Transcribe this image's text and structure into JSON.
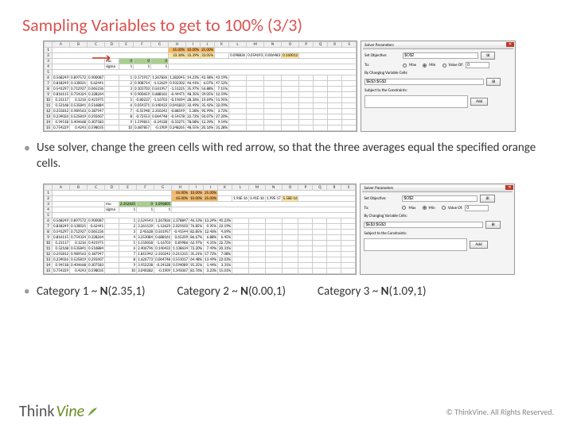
{
  "title": "Sampling Variables to get to 100% (3/3)",
  "bullet1": "Use solver, change the green cells with red arrow, so that the three averages equal the specified orange cells.",
  "cat1": "Category 1 ~ N(2.35,1)",
  "cat2": "Category 2 ~ N(0.00,1)",
  "cat3": "Category 3 ~ N(1.09,1)",
  "footer": {
    "brand1": "Think",
    "brand2": "Vine",
    "copy": "© ThinkVine.  All Rights Reserved."
  },
  "cols": [
    "A",
    "B",
    "C",
    "D",
    "E",
    "F",
    "G",
    "H",
    "I",
    "J",
    "K",
    "L",
    "M",
    "N",
    "O",
    "P",
    "Q",
    "R",
    "S"
  ],
  "solver": {
    "title": "Solver Parameters",
    "obj_lbl": "Set Objective:",
    "obj_val": "$O$2",
    "to_lbl": "To:",
    "max": "Max",
    "min": "Min",
    "valof": "Value Of:",
    "zero": "0",
    "chg_lbl": "By Changing Variable Cells:",
    "chg_val": "$E$3:$G$3",
    "sub_lbl": "Subject to the Constraints:",
    "add": "Add"
  },
  "shot1": {
    "mu_lbl": "mu",
    "sigma_lbl": "sigma",
    "mu": [
      "0",
      "0",
      "0"
    ],
    "sigma": [
      "1",
      "1",
      "1"
    ],
    "r1_orange": [
      "65.00%",
      "10.00%",
      "25.00%"
    ],
    "r2_yellow": [
      "33.36%",
      "33.39%",
      "33.05%"
    ],
    "r2_L": [
      "0.098836",
      "0.054693",
      "0.006483"
    ],
    "r2_Lsum": "0.160012",
    "rows": [
      [
        "6",
        "0.568249",
        "0.897572",
        "0.900087",
        "",
        "1",
        "0.171917",
        "1.267836",
        "1.282045",
        "14.23%",
        "42.58%",
        "43.19%"
      ],
      [
        "7",
        "0.818249",
        "0.130021",
        "0.62441",
        "",
        "2",
        "0.908714",
        "-1.12629",
        "0.932302",
        "46.41%",
        "6.07%",
        "47.52%"
      ],
      [
        "8",
        "0.541297",
        "0.712927",
        "0.065236",
        "",
        "3",
        "0.103703",
        "0.561957",
        "-1.51225",
        "35.97%",
        "56.88%",
        "7.15%"
      ],
      [
        "9",
        "0.816115",
        "0.754324",
        "0.328264",
        "",
        "4",
        "0.900659",
        "0.688161",
        "-0.44471",
        "48.35%",
        "39.05%",
        "12.59%"
      ],
      [
        "10",
        "0.21117",
        "0.1216",
        "0.421975",
        "",
        "5",
        "-0.80237",
        "-1.16703",
        "-0.19694",
        "28.36%",
        "19.69%",
        "51.95%"
      ],
      [
        "11",
        "0.52168",
        "0.535841",
        "0.516884",
        "",
        "6",
        "0.054371",
        "0.140433",
        "0.041833",
        "32.49%",
        "35.42%",
        "32.09%"
      ],
      [
        "12",
        "0.255812",
        "0.989563",
        "0.187947",
        "",
        "7",
        "-0.55948",
        "2.310242",
        "-0.88549",
        "5.28%",
        "90.99%",
        "3.72%"
      ],
      [
        "13",
        "0.234026",
        "0.525819",
        "0.292607",
        "",
        "8",
        "-0.72553",
        "0.064748",
        "-0.54578",
        "22.72%",
        "50.07%",
        "27.20%"
      ],
      [
        "14",
        "0.94518",
        "0.404668",
        "0.307583",
        "",
        "9",
        "1.599811",
        "-0.24128",
        "-0.50271",
        "78.08%",
        "12.39%",
        "9.54%"
      ],
      [
        "15",
        "0.754229",
        "0.4243",
        "0.598035",
        "",
        "10",
        "0.687857",
        "-0.1909",
        "0.248265",
        "48.55%",
        "20.16%",
        "31.28%"
      ]
    ]
  },
  "shot2": {
    "mu_lbl": "mu",
    "sigma_lbl": "sigma",
    "mu": [
      "2.352625",
      "0",
      "1.096801"
    ],
    "sigma": [
      "1",
      "1",
      "1"
    ],
    "r1_orange": [
      "65.00%",
      "10.00%",
      "25.00%"
    ],
    "r2_orange": [
      "65.00%",
      "10.00%",
      "25.00%"
    ],
    "r2_L": [
      "1.96E-16",
      "3.41E-16",
      "1.99E-17"
    ],
    "r2_Lsum": "5.58E-16",
    "rows": [
      [
        "6",
        "0.568249",
        "0.897572",
        "0.900087",
        "",
        "1",
        "2.524543",
        "1.267836",
        "2.378847",
        "46.53%",
        "13.24%",
        "40.23%"
      ],
      [
        "7",
        "0.818249",
        "0.130021",
        "0.62441",
        "",
        "2",
        "3.261139",
        "-1.12629",
        "2.029103",
        "76.85%",
        "0.95%",
        "22.19%"
      ],
      [
        "8",
        "0.541297",
        "0.712927",
        "0.065236",
        "",
        "3",
        "2.45628",
        "0.561957",
        "-0.41544",
        "82.85%",
        "12.46%",
        "4.69%"
      ],
      [
        "9",
        "0.816115",
        "0.754324",
        "0.328264",
        "",
        "4",
        "3.253084",
        "0.688161",
        "0.65209",
        "86.67%",
        "6.88%",
        "6.45%"
      ],
      [
        "10",
        "0.21117",
        "0.1216",
        "0.421975",
        "",
        "5",
        "1.550058",
        "-1.16703",
        "0.89986",
        "62.97%",
        "4.31%",
        "32.72%"
      ],
      [
        "11",
        "0.52168",
        "0.535841",
        "0.516884",
        "",
        "6",
        "2.406796",
        "0.140433",
        "1.138634",
        "72.20%",
        "7.49%",
        "20.31%"
      ],
      [
        "12",
        "0.255812",
        "0.989563",
        "0.187947",
        "",
        "7",
        "1.815942",
        "2.310242",
        "0.211315",
        "35.21%",
        "57.72%",
        "7.08%"
      ],
      [
        "13",
        "0.234026",
        "0.525819",
        "0.292607",
        "",
        "8",
        "1.626773",
        "0.064748",
        "0.551017",
        "64.48%",
        "13.49%",
        "22.03%"
      ],
      [
        "14",
        "0.94518",
        "0.404668",
        "0.307583",
        "",
        "9",
        "3.952238",
        "-0.24128",
        "0.594089",
        "95.25%",
        "1.44%",
        "3.31%"
      ],
      [
        "15",
        "0.754229",
        "0.4243",
        "0.598035",
        "",
        "10",
        "3.040282",
        "-0.1909",
        "1.345067",
        "81.76%",
        "3.23%",
        "15.01%"
      ]
    ]
  }
}
